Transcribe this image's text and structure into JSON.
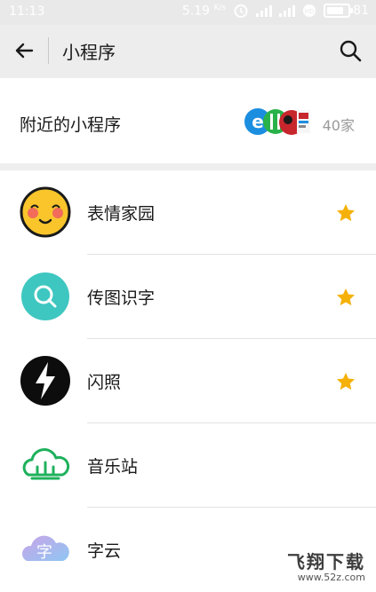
{
  "status_bar": {
    "time": "11:13",
    "speed": "5.19",
    "speed_unit": "K/s",
    "battery": "81"
  },
  "header": {
    "title": "小程序"
  },
  "nearby": {
    "label": "附近的小程序",
    "count": "40家"
  },
  "items": [
    {
      "name": "表情家园",
      "starred": true,
      "icon": "emoji-face-icon"
    },
    {
      "name": "传图识字",
      "starred": true,
      "icon": "magnifier-circle-icon"
    },
    {
      "name": "闪照",
      "starred": true,
      "icon": "lightning-icon"
    },
    {
      "name": "音乐站",
      "starred": false,
      "icon": "music-cloud-icon"
    },
    {
      "name": "字云",
      "starred": false,
      "icon": "word-cloud-icon"
    }
  ],
  "watermark": {
    "title": "飞翔下载",
    "url": "www.52z.com"
  },
  "colors": {
    "star": "#f5b10a",
    "teal": "#3ec7c0",
    "music_green": "#1fb15c"
  }
}
